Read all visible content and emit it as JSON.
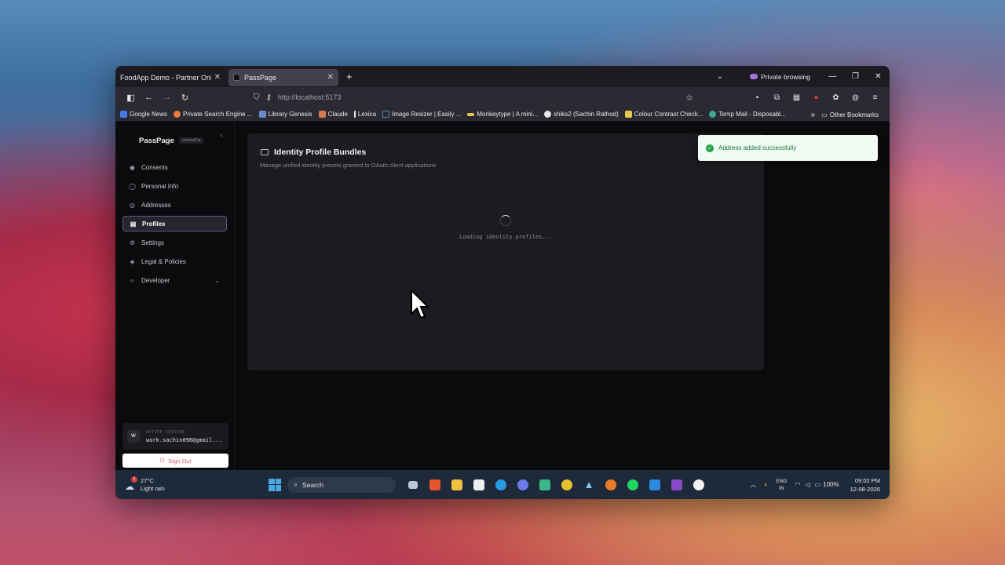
{
  "browser": {
    "tabs": [
      {
        "title": "FoodApp Demo - Partner Onboardi",
        "active": false
      },
      {
        "title": "PassPage",
        "active": true
      }
    ],
    "private_label": "Private browsing",
    "url": "http://localhost:5173",
    "bookmarks": [
      {
        "label": "Google News",
        "color": "#4a7ae8"
      },
      {
        "label": "Private Search Engine ...",
        "color": "#e87a3a"
      },
      {
        "label": "Library Genesis",
        "color": "#6a8ac8"
      },
      {
        "label": "Claude",
        "color": "#d87a4a"
      },
      {
        "label": "Lexica",
        "color": "#e8e8e8"
      },
      {
        "label": "Image Resizer | Easily ...",
        "color": "#4a8ac8"
      },
      {
        "label": "Monkeytype | A mini...",
        "color": "#e8c84a"
      },
      {
        "label": "shiks2 (Sachin Rathod)",
        "color": "#e8e8e8"
      },
      {
        "label": "Colour Contrast Check...",
        "color": "#e8c84a"
      },
      {
        "label": "Temp Mail - Disposabl...",
        "color": "#3aa88a"
      }
    ],
    "other_bookmarks": "Other Bookmarks"
  },
  "app": {
    "brand": "PassPage",
    "brand_tag": "console",
    "nav": [
      {
        "label": "Consents",
        "icon": "consents-icon",
        "glyph": "◉"
      },
      {
        "label": "Personal Info",
        "icon": "user-icon",
        "glyph": "◯"
      },
      {
        "label": "Addresses",
        "icon": "location-pin-icon",
        "glyph": "◎"
      },
      {
        "label": "Profiles",
        "icon": "id-card-icon",
        "glyph": "▤",
        "active": true
      },
      {
        "label": "Settings",
        "icon": "gear-icon",
        "glyph": "⚙"
      },
      {
        "label": "Legal & Policies",
        "icon": "shield-icon",
        "glyph": "◈"
      },
      {
        "label": "Developer",
        "icon": "code-icon",
        "glyph": "‹›"
      }
    ],
    "session": {
      "avatar": "W",
      "label": "ACTIVE SESSION",
      "email": "work.sachin098@gmail..."
    },
    "signout": "Sign Out",
    "card": {
      "title": "Identity Profile Bundles",
      "subtitle": "Manage unified identity presets granted to OAuth client applications",
      "loading": "Loading identity profiles..."
    },
    "toast": {
      "message": "Address added successfully",
      "color": "#22a04a"
    }
  },
  "taskbar": {
    "temp": "27°C",
    "weather": "Light rain",
    "badge": "1",
    "search_placeholder": "Search",
    "lang_top": "ENG",
    "lang_bottom": "IN",
    "battery": "100%",
    "time": "09:02 PM",
    "date": "12-08-2026"
  }
}
